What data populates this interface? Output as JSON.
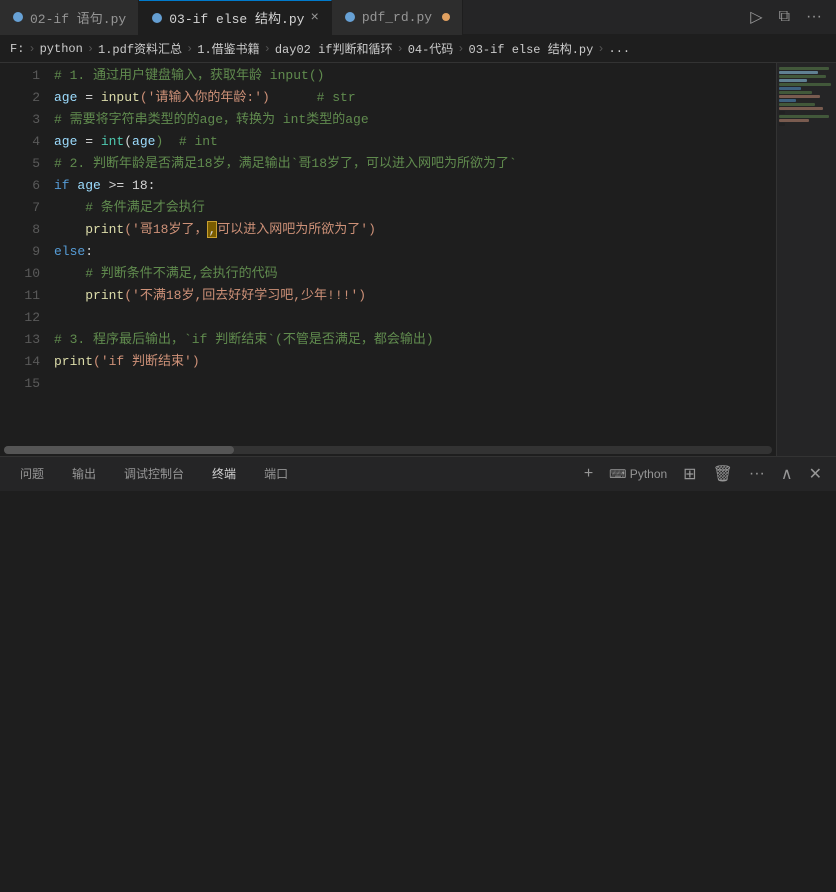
{
  "tabs": [
    {
      "id": "tab1",
      "label": "02-if 语句.py",
      "icon_color": "#75beff",
      "active": false,
      "closeable": false,
      "dirty": false
    },
    {
      "id": "tab2",
      "label": "03-if else 结构.py",
      "icon_color": "#75beff",
      "active": true,
      "closeable": true,
      "dirty": false
    },
    {
      "id": "tab3",
      "label": "pdf_rd.py",
      "icon_color": "#75beff",
      "active": false,
      "closeable": false,
      "dirty": true
    }
  ],
  "tab_actions": {
    "run": "▷",
    "split": "⧉",
    "more": "···"
  },
  "breadcrumb": {
    "items": [
      "F:",
      "python",
      "1.pdf资料汇总",
      "1.借鉴书籍",
      "day02 if判断和循环",
      "04-代码",
      "03-if else 结构.py",
      "..."
    ]
  },
  "code_lines": [
    {
      "num": 1,
      "tokens": [
        {
          "text": "# 1. 通过用户键盘输入，获取年龄 input()",
          "class": "c-comment"
        }
      ]
    },
    {
      "num": 2,
      "tokens": [
        {
          "text": "age",
          "class": "c-variable"
        },
        {
          "text": " = ",
          "class": "c-plain"
        },
        {
          "text": "input",
          "class": "c-function"
        },
        {
          "text": "('请输入你的年龄:')",
          "class": "c-string"
        },
        {
          "text": "      # str",
          "class": "c-comment"
        }
      ]
    },
    {
      "num": 3,
      "tokens": [
        {
          "text": "# 需要将字符串类型的的age，转换为 int类型的age",
          "class": "c-comment"
        }
      ]
    },
    {
      "num": 4,
      "tokens": [
        {
          "text": "age",
          "class": "c-variable"
        },
        {
          "text": " = ",
          "class": "c-plain"
        },
        {
          "text": "int",
          "class": "c-type"
        },
        {
          "text": "(",
          "class": "c-plain"
        },
        {
          "text": "age",
          "class": "c-variable"
        },
        {
          "text": ")  # int",
          "class": "c-comment"
        }
      ]
    },
    {
      "num": 5,
      "tokens": [
        {
          "text": "# 2. 判断年龄是否满足18岁，满足输出`哥18岁了，可以进入网吧为所欲为了`",
          "class": "c-comment"
        }
      ]
    },
    {
      "num": 6,
      "tokens": [
        {
          "text": "if",
          "class": "c-keyword"
        },
        {
          "text": " ",
          "class": "c-plain"
        },
        {
          "text": "age",
          "class": "c-variable"
        },
        {
          "text": " >= 18:",
          "class": "c-plain"
        }
      ]
    },
    {
      "num": 7,
      "tokens": [
        {
          "text": "    # 条件满足才会执行",
          "class": "c-comment"
        }
      ]
    },
    {
      "num": 8,
      "tokens": [
        {
          "text": "    ",
          "class": "c-plain"
        },
        {
          "text": "print",
          "class": "c-function"
        },
        {
          "text": "('哥18岁了，",
          "class": "c-string"
        },
        {
          "text": ",",
          "class": "c-plain",
          "highlight": true
        },
        {
          "text": "可以进入网吧为所欲为了')",
          "class": "c-string"
        }
      ]
    },
    {
      "num": 9,
      "tokens": [
        {
          "text": "else",
          "class": "c-keyword"
        },
        {
          "text": ":",
          "class": "c-plain"
        }
      ]
    },
    {
      "num": 10,
      "tokens": [
        {
          "text": "    # 判断条件不满足,会执行的代码",
          "class": "c-comment"
        }
      ]
    },
    {
      "num": 11,
      "tokens": [
        {
          "text": "    ",
          "class": "c-plain"
        },
        {
          "text": "print",
          "class": "c-function"
        },
        {
          "text": "('不满18岁,回去好好学习吧,少年!!!')",
          "class": "c-string"
        }
      ]
    },
    {
      "num": 12,
      "tokens": []
    },
    {
      "num": 13,
      "tokens": [
        {
          "text": "# 3. 程序最后输出，`if 判断结束`(不管是否满足，都会输出)",
          "class": "c-comment"
        }
      ]
    },
    {
      "num": 14,
      "tokens": [
        {
          "text": "print",
          "class": "c-function"
        },
        {
          "text": "('if 判断结束')",
          "class": "c-string"
        }
      ]
    },
    {
      "num": 15,
      "tokens": []
    }
  ],
  "panel": {
    "tabs": [
      {
        "label": "问题",
        "active": false
      },
      {
        "label": "输出",
        "active": false
      },
      {
        "label": "调试控制台",
        "active": false
      },
      {
        "label": "终端",
        "active": true
      },
      {
        "label": "端口",
        "active": false
      }
    ],
    "actions": {
      "add": "+",
      "shell": "Python",
      "layout": "⊞",
      "trash": "🗑",
      "more": "···",
      "collapse": "∧",
      "close": "✕"
    }
  }
}
